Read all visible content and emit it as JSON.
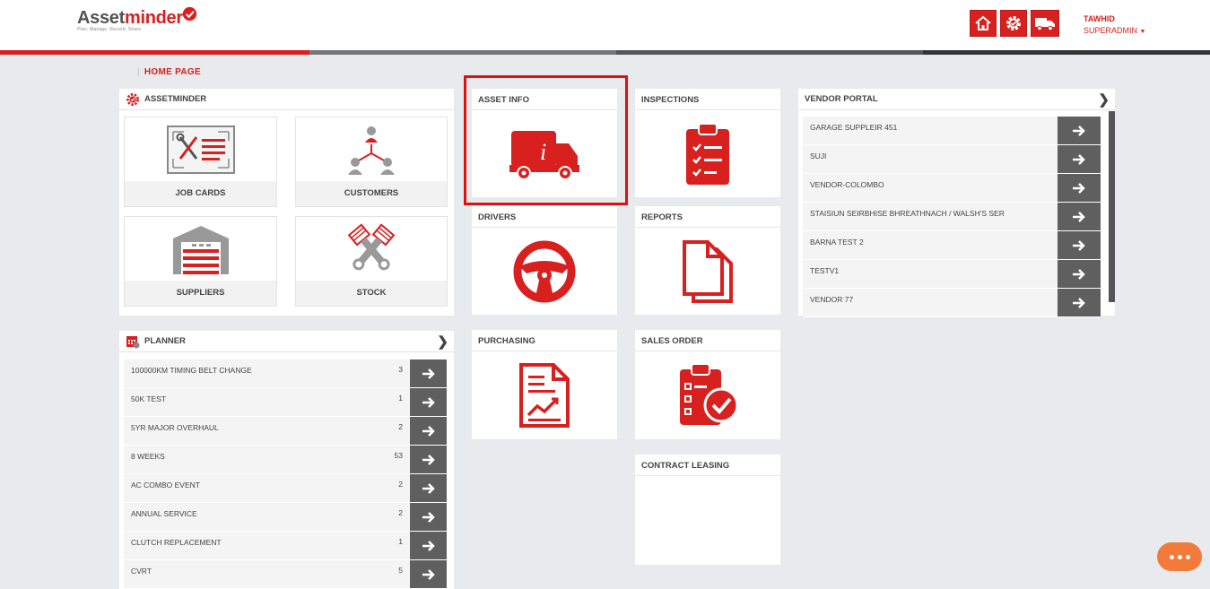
{
  "header": {
    "logo_main": "Asset",
    "logo_accent": "minder",
    "logo_tagline": "Plan. Manage. Record. Share.",
    "user_name": "TAWHID",
    "user_role": "SUPERADMIN",
    "icons": [
      "home-icon",
      "settings-gear-icon",
      "truck-icon"
    ]
  },
  "breadcrumb": {
    "separator": "|",
    "current": "HOME PAGE"
  },
  "assetminder": {
    "title": "ASSETMINDER",
    "tiles": [
      {
        "label": "JOB CARDS",
        "icon": "job-cards-icon"
      },
      {
        "label": "CUSTOMERS",
        "icon": "customers-icon"
      },
      {
        "label": "SUPPLIERS",
        "icon": "suppliers-icon"
      },
      {
        "label": "STOCK",
        "icon": "stock-icon"
      }
    ]
  },
  "cards": {
    "asset_info": "ASSET INFO",
    "inspections": "INSPECTIONS",
    "drivers": "DRIVERS",
    "reports": "REPORTS",
    "purchasing": "PURCHASING",
    "sales_order": "SALES ORDER",
    "contract_leasing": "CONTRACT LEASING"
  },
  "planner": {
    "title": "PLANNER",
    "items": [
      {
        "label": "100000KM TIMING BELT CHANGE",
        "count": "3"
      },
      {
        "label": "50K TEST",
        "count": "1"
      },
      {
        "label": "5YR MAJOR OVERHAUL",
        "count": "2"
      },
      {
        "label": "8 WEEKS",
        "count": "53"
      },
      {
        "label": "AC COMBO EVENT",
        "count": "2"
      },
      {
        "label": "ANNUAL SERVICE",
        "count": "2"
      },
      {
        "label": "CLUTCH REPLACEMENT",
        "count": "1"
      },
      {
        "label": "CVRT",
        "count": "5"
      }
    ]
  },
  "vendor_portal": {
    "title": "VENDOR PORTAL",
    "items": [
      {
        "label": "GARAGE SUPPLEIR 451"
      },
      {
        "label": "SUJI"
      },
      {
        "label": "VENDOR-COLOMBO"
      },
      {
        "label": "STAISIUN SEIRBHISE BHREATHNACH / WALSH'S SER"
      },
      {
        "label": "BARNA TEST 2"
      },
      {
        "label": "TESTV1"
      },
      {
        "label": "VENDOR 77"
      }
    ]
  },
  "colors": {
    "accent": "#d8201f",
    "background": "#e9eaed",
    "button_dark": "#5f5f5f",
    "chat": "#f27a3a"
  }
}
